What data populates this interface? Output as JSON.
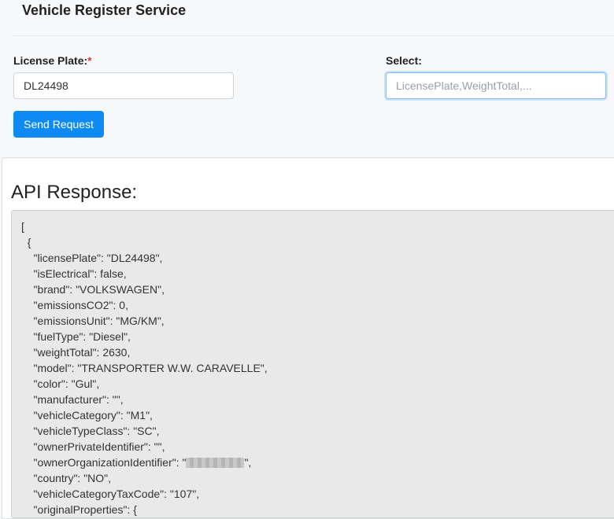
{
  "header": {
    "title": "Vehicle Register Service"
  },
  "form": {
    "license_plate_label": "License Plate:",
    "required_marker": "*",
    "license_plate_value": "DL24498",
    "select_label": "Select:",
    "select_placeholder": "LicensePlate,WeightTotal,...",
    "send_button_label": "Send Request"
  },
  "response": {
    "title": "API Response:",
    "lines": [
      "[",
      "  {",
      "    \"licensePlate\": \"DL24498\",",
      "    \"isElectrical\": false,",
      "    \"brand\": \"VOLKSWAGEN\",",
      "    \"emissionsCO2\": 0,",
      "    \"emissionsUnit\": \"MG/KM\",",
      "    \"fuelType\": \"Diesel\",",
      "    \"weightTotal\": 2630,",
      "    \"model\": \"TRANSPORTER W.W. CARAVELLE\",",
      "    \"color\": \"Gul\",",
      "    \"manufacturer\": \"\",",
      "    \"vehicleCategory\": \"M1\",",
      "    \"vehicleTypeClass\": \"SC\",",
      "    \"ownerPrivateIdentifier\": \"\",",
      "    \"ownerOrganizationIdentifier\": \"",
      "    \"country\": \"NO\",",
      "    \"vehicleCategoryTaxCode\": \"107\",",
      "    \"originalProperties\": {"
    ],
    "redacted_line_suffix": "\","
  },
  "colors": {
    "accent": "#0d8af4",
    "required": "#dc3545",
    "code_background": "#e9e9e9"
  }
}
